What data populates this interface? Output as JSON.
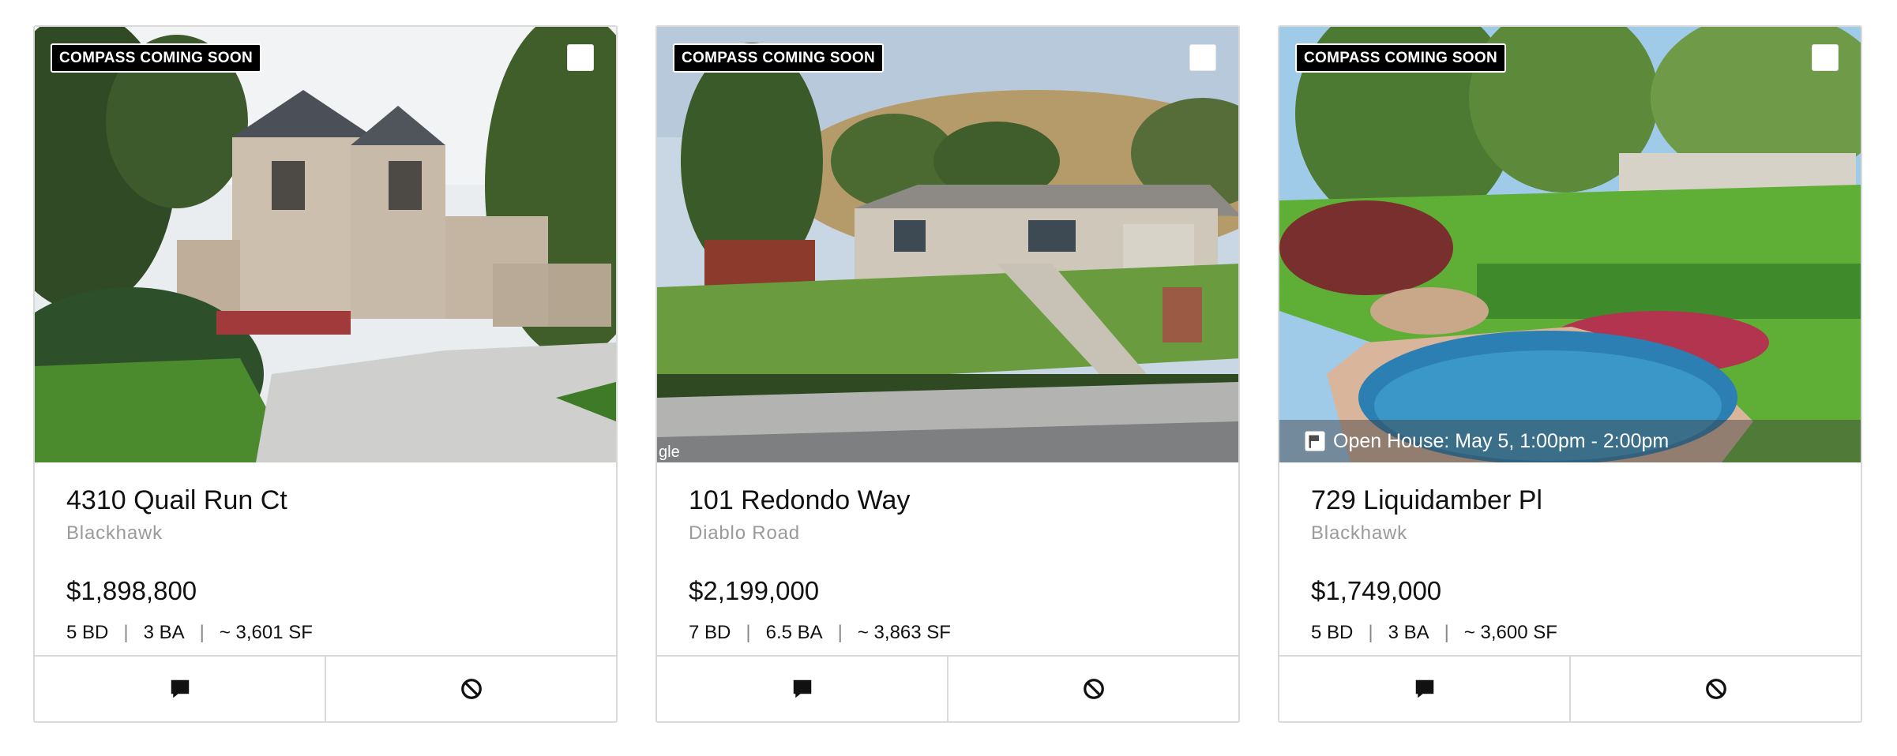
{
  "listings": [
    {
      "badge": "COMPASS COMING SOON",
      "address": "4310 Quail Run Ct",
      "area": "Blackhawk",
      "price": "$1,898,800",
      "beds": "5 BD",
      "baths": "3 BA",
      "sqft": "~ 3,601 SF",
      "open_house": null
    },
    {
      "badge": "COMPASS COMING SOON",
      "address": "101 Redondo Way",
      "area": "Diablo Road",
      "price": "$2,199,000",
      "beds": "7 BD",
      "baths": "6.5 BA",
      "sqft": "~ 3,863 SF",
      "open_house": null,
      "photo_watermark": "gle"
    },
    {
      "badge": "COMPASS COMING SOON",
      "address": "729 Liquidamber Pl",
      "area": "Blackhawk",
      "price": "$1,749,000",
      "beds": "5 BD",
      "baths": "3 BA",
      "sqft": "~ 3,600 SF",
      "open_house": "Open House: May 5, 1:00pm - 2:00pm"
    }
  ],
  "icons": {
    "message": "message-icon",
    "hide": "block-icon",
    "open_house": "calendar-flag-icon"
  }
}
